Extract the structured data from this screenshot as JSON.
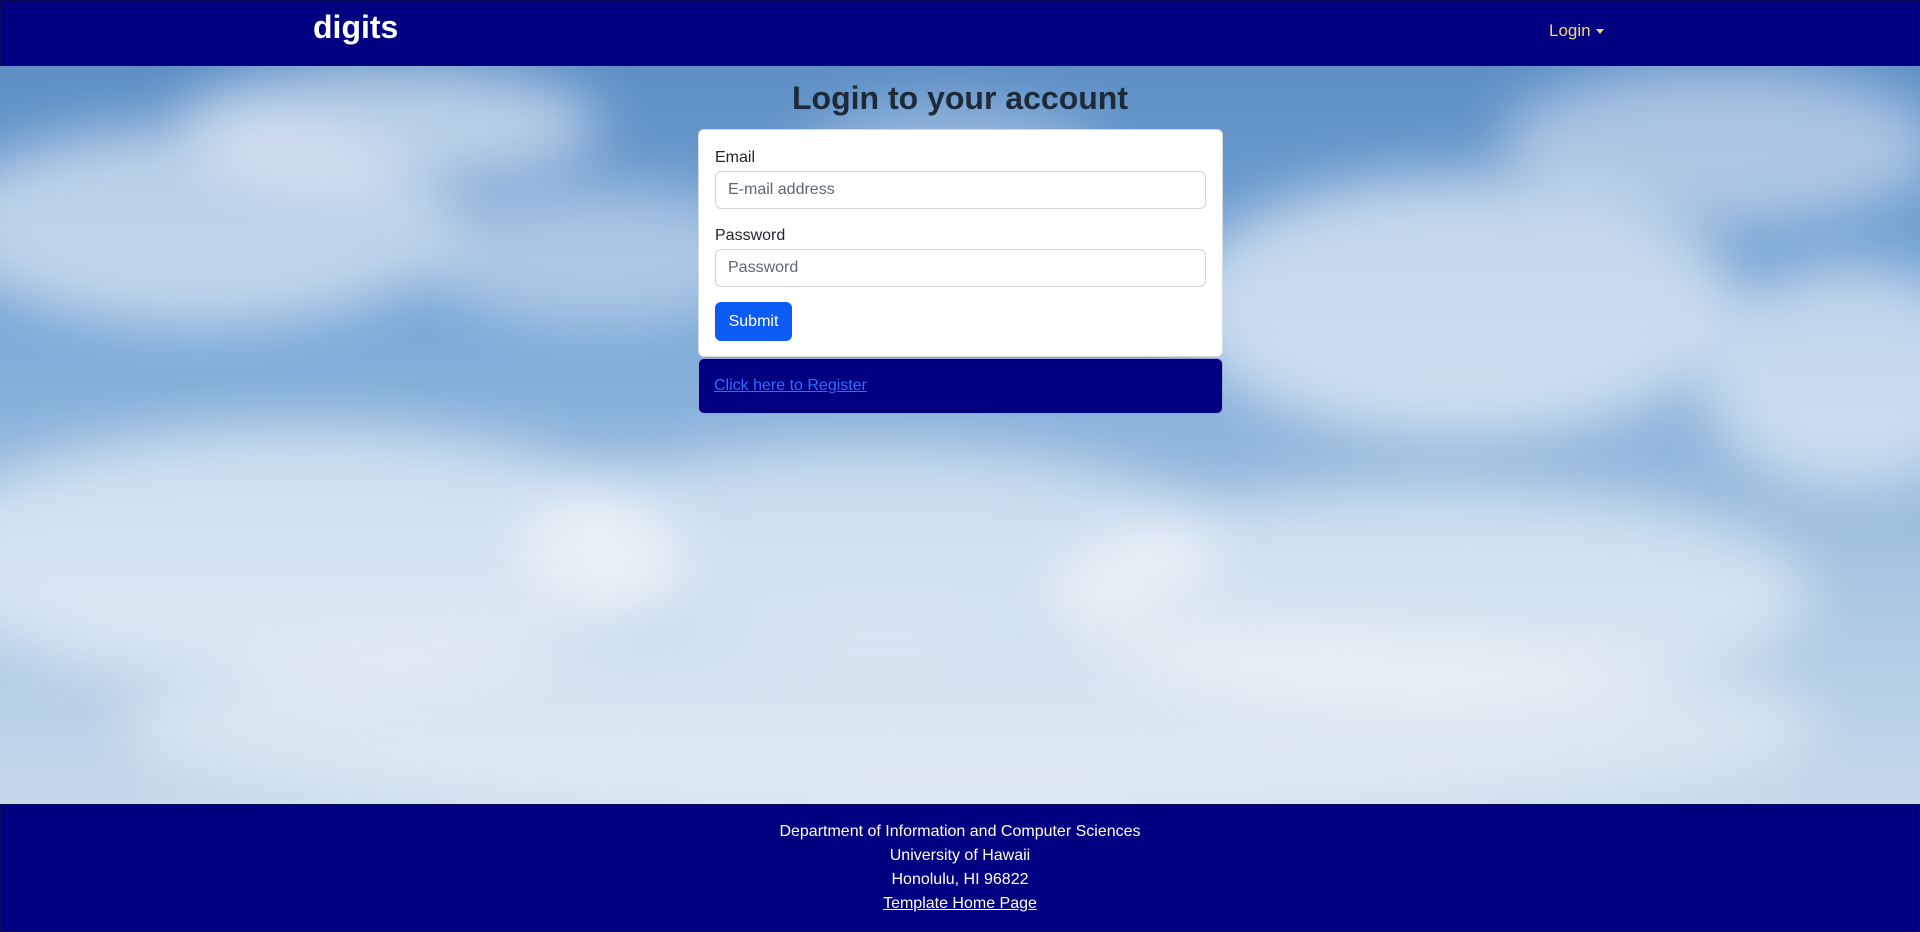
{
  "navbar": {
    "brand": "digits",
    "login_menu_label": "Login",
    "background_color": "#000080"
  },
  "login": {
    "title": "Login to your account",
    "email_label": "Email",
    "email_placeholder": "E-mail address",
    "email_value": "",
    "password_label": "Password",
    "password_placeholder": "Password",
    "password_value": "",
    "submit_label": "Submit",
    "submit_color": "#0d5bf5"
  },
  "register": {
    "link_text": "Click here to Register"
  },
  "footer": {
    "line1": "Department of Information and Computer Sciences",
    "line2": "University of Hawaii",
    "line3": "Honolulu, HI 96822",
    "link_text": "Template Home Page"
  }
}
